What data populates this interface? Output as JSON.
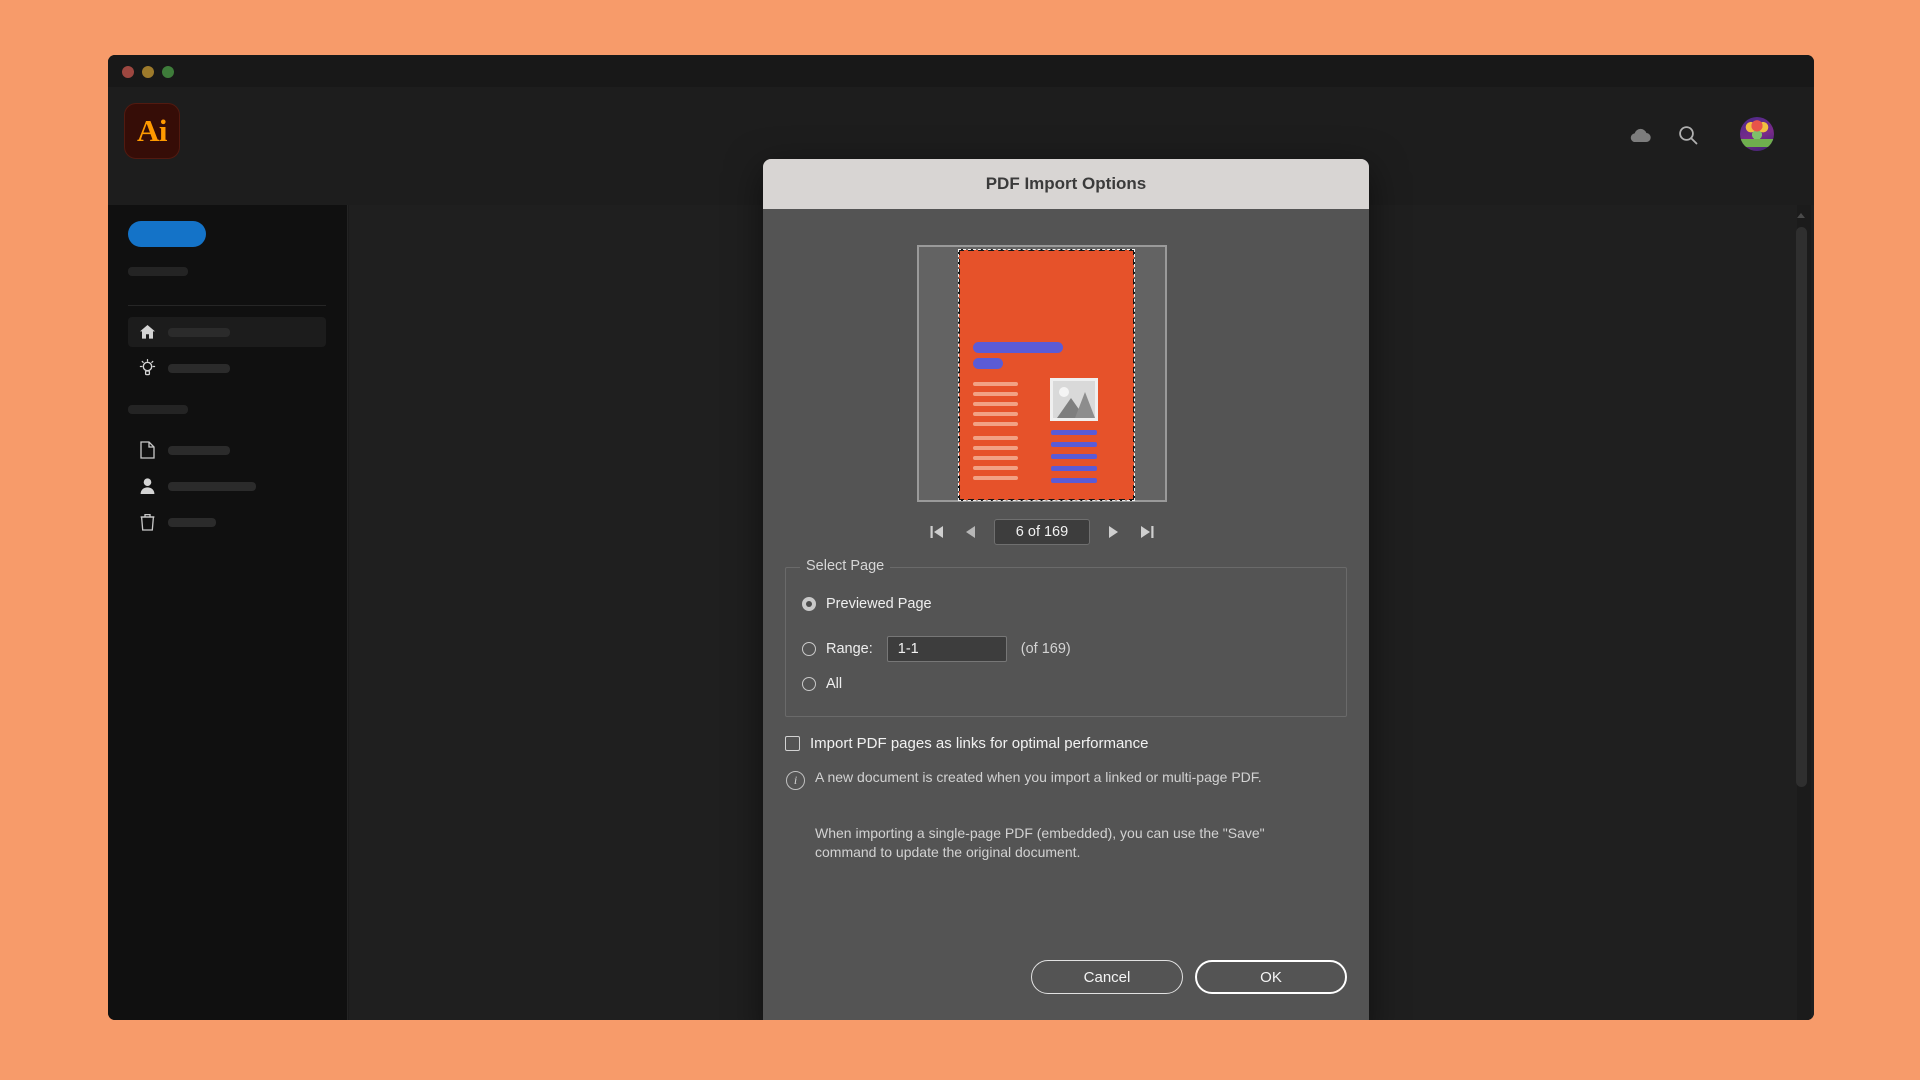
{
  "app": {
    "logo_text": "Ai",
    "header_icons": [
      {
        "name": "cloud-icon",
        "label": "Cloud"
      },
      {
        "name": "search-icon",
        "label": "Search"
      },
      {
        "name": "avatar",
        "label": "Account"
      }
    ]
  },
  "dialog": {
    "title": "PDF Import Options",
    "page_nav": {
      "first_label": "First page",
      "prev_label": "Previous page",
      "indicator": "6 of 169",
      "next_label": "Next page",
      "last_label": "Last page"
    },
    "select_page": {
      "legend": "Select Page",
      "options": [
        {
          "label": "Previewed Page",
          "selected": true
        },
        {
          "label": "Range:",
          "selected": false
        },
        {
          "label": "All",
          "selected": false
        }
      ],
      "range_value": "1-1",
      "range_total": "(of 169)"
    },
    "links_checkbox": {
      "label": "Import PDF pages as links for optimal performance",
      "checked": false
    },
    "info": {
      "icon": "info-circle-icon",
      "text_1": "A new document is created when you import a linked or multi-page PDF.",
      "text_2": "When importing a single-page PDF (embedded), you can use the \"Save\" command to update the original document."
    },
    "buttons": {
      "cancel": "Cancel",
      "ok": "OK"
    }
  },
  "colors": {
    "accent_orange": "#e6522a",
    "dialog_bg": "#545454",
    "titlebar_bg": "#d8d5d3",
    "sidebar_cta": "#1473c8",
    "preview_blue": "#5b5bd6"
  }
}
